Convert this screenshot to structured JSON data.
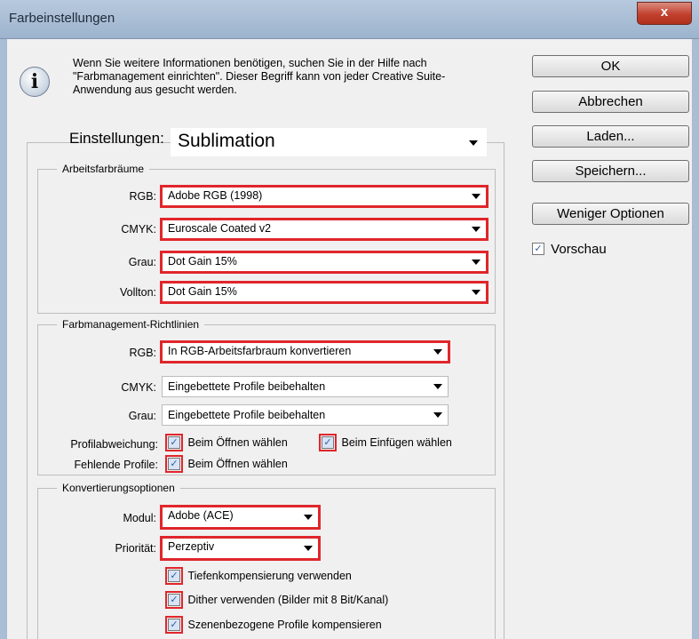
{
  "window": {
    "title": "Farbeinstellungen",
    "close_label": "x"
  },
  "info": {
    "icon": "info-icon",
    "text": "Wenn Sie weitere Informationen benötigen, suchen Sie in der Hilfe nach \"Farbmanagement einrichten\". Dieser Begriff kann von jeder Creative Suite-Anwendung aus gesucht werden."
  },
  "buttons": {
    "ok": "OK",
    "cancel": "Abbrechen",
    "load": "Laden...",
    "save": "Speichern...",
    "fewer": "Weniger Optionen"
  },
  "preview": {
    "label": "Vorschau",
    "checked": true
  },
  "settings": {
    "label": "Einstellungen:",
    "value": "Sublimation"
  },
  "workspaces": {
    "legend": "Arbeitsfarbräume",
    "rgb": {
      "label": "RGB:",
      "value": "Adobe RGB (1998)"
    },
    "cmyk": {
      "label": "CMYK:",
      "value": "Euroscale Coated v2"
    },
    "gray": {
      "label": "Grau:",
      "value": "Dot Gain 15%"
    },
    "spot": {
      "label": "Vollton:",
      "value": "Dot Gain 15%"
    }
  },
  "policies": {
    "legend": "Farbmanagement-Richtlinien",
    "rgb": {
      "label": "RGB:",
      "value": "In RGB-Arbeitsfarbraum konvertieren"
    },
    "cmyk": {
      "label": "CMYK:",
      "value": "Eingebettete Profile beibehalten"
    },
    "gray": {
      "label": "Grau:",
      "value": "Eingebettete Profile beibehalten"
    },
    "mismatch_label": "Profilabweichung:",
    "mismatch_open": "Beim Öffnen wählen",
    "mismatch_paste": "Beim Einfügen wählen",
    "missing_label": "Fehlende Profile:",
    "missing_open": "Beim Öffnen wählen"
  },
  "conversion": {
    "legend": "Konvertierungsoptionen",
    "engine": {
      "label": "Modul:",
      "value": "Adobe (ACE)"
    },
    "intent": {
      "label": "Priorität:",
      "value": "Perzeptiv"
    },
    "bpc": "Tiefenkompensierung verwenden",
    "dither": "Dither verwenden (Bilder mit 8 Bit/Kanal)",
    "scene": "Szenenbezogene Profile kompensieren"
  },
  "colors": {
    "highlight": "#e0262b",
    "titlebar": "#9db3cd",
    "background": "#f0f0f0"
  }
}
